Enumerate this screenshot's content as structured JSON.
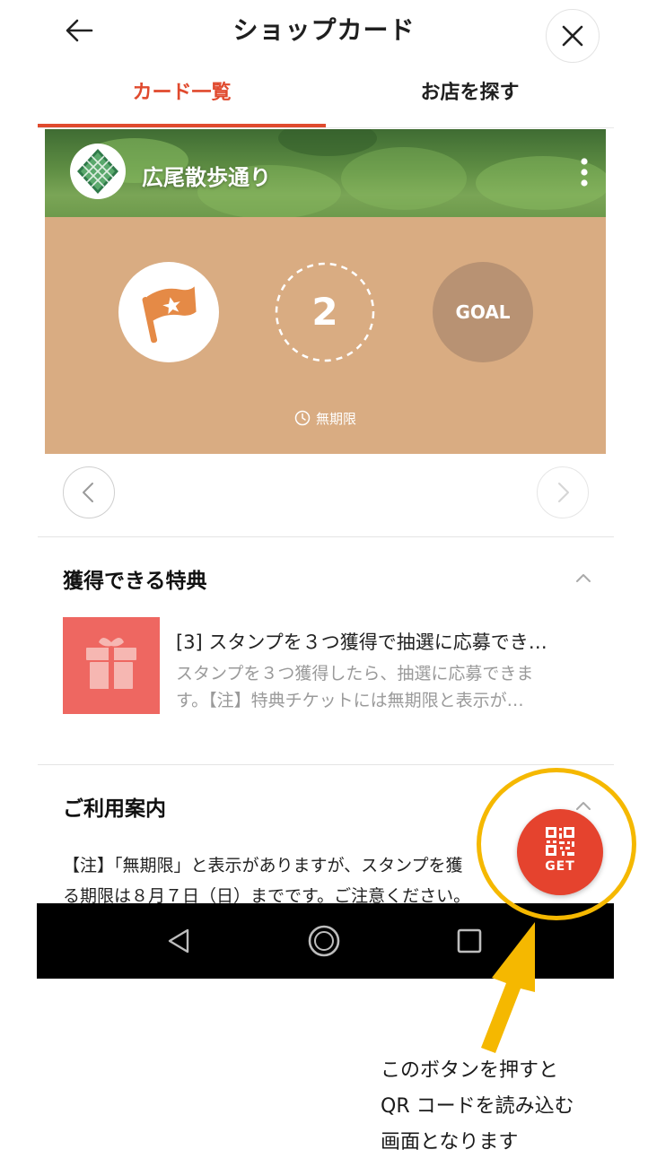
{
  "header": {
    "title": "ショップカード"
  },
  "tabs": [
    {
      "label": "カード一覧",
      "active": true
    },
    {
      "label": "お店を探す",
      "active": false
    }
  ],
  "card": {
    "name": "広尾散歩通り",
    "stamp_count": "2",
    "goal_label": "GOAL",
    "expiry": "無期限"
  },
  "benefits": {
    "title": "獲得できる特典",
    "item": {
      "title": "[3] スタンプを３つ獲得で抽選に応募でき…",
      "desc_line1": "スタンプを３つ獲得したら、抽選に応募できま",
      "desc_line2": "す。【注】特典チケットには無期限と表示が…"
    }
  },
  "info": {
    "title": "ご利用案内",
    "line1": "【注】「無期限」と表示がありますが、スタンプを獲",
    "line2": "る期限は８月７日（日）までです。ご注意ください。"
  },
  "fab": {
    "label": "GET"
  },
  "annotation": {
    "line1": "このボタンを押すと",
    "line2": "QR コードを読み込む",
    "line3": "画面となります"
  },
  "colors": {
    "accent": "#e04a2e",
    "card_body": "#d9ac82",
    "goal_circle": "#b89273",
    "gift": "#ee6761",
    "fab": "#e5432e",
    "highlight": "#f5b800"
  }
}
